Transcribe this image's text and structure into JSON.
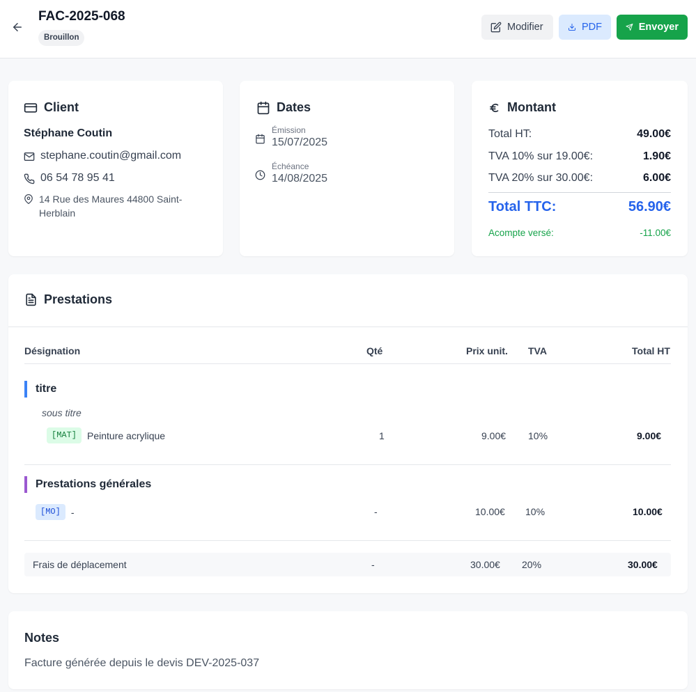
{
  "header": {
    "invoice_number": "FAC-2025-068",
    "status": "Brouillon",
    "buttons": {
      "modifier": "Modifier",
      "pdf": "PDF",
      "envoyer": "Envoyer"
    }
  },
  "client": {
    "title": "Client",
    "name": "Stéphane Coutin",
    "email": "stephane.coutin@gmail.com",
    "phone": "06 54 78 95 41",
    "address": "14 Rue des Maures 44800 Saint-Herblain"
  },
  "dates": {
    "title": "Dates",
    "emission_label": "Émission",
    "emission_value": "15/07/2025",
    "echeance_label": "Échéance",
    "echeance_value": "14/08/2025"
  },
  "montant": {
    "title": "Montant",
    "total_ht_label": "Total HT:",
    "total_ht_value": "49.00€",
    "tva10_label": "TVA 10% sur 19.00€:",
    "tva10_value": "1.90€",
    "tva20_label": "TVA 20% sur 30.00€:",
    "tva20_value": "6.00€",
    "total_ttc_label": "Total TTC:",
    "total_ttc_value": "56.90€",
    "acompte_label": "Acompte versé:",
    "acompte_value": "-11.00€"
  },
  "prestations": {
    "title": "Prestations",
    "columns": {
      "designation": "Désignation",
      "qte": "Qté",
      "prix": "Prix unit.",
      "tva": "TVA",
      "total": "Total HT"
    },
    "sections": [
      {
        "title": "titre",
        "subtitle": "sous titre",
        "items": [
          {
            "tag": "[MAT]",
            "label": "Peinture acrylique",
            "qte": "1",
            "prix": "9.00€",
            "tva": "10%",
            "total": "9.00€"
          }
        ]
      },
      {
        "title": "Prestations générales",
        "items": [
          {
            "tag": "[MO]",
            "label": "-",
            "qte": "-",
            "prix": "10.00€",
            "tva": "10%",
            "total": "10.00€"
          }
        ]
      }
    ],
    "extra": {
      "label": "Frais de déplacement",
      "qte": "-",
      "prix": "30.00€",
      "tva": "20%",
      "total": "30.00€"
    }
  },
  "notes": {
    "title": "Notes",
    "text": "Facture générée depuis le devis DEV-2025-037"
  },
  "colors": {
    "accent_green": "#16a34a",
    "accent_blue": "#2563eb",
    "section_blue": "#3b82f6",
    "section_purple": "#9b59d0"
  },
  "icons": {
    "back": "arrow-left-icon",
    "modifier": "edit-icon",
    "pdf": "download-icon",
    "envoyer": "send-icon",
    "client": "card-icon",
    "dates": "calendar-icon",
    "montant": "euro-icon",
    "prestations": "document-icon"
  }
}
